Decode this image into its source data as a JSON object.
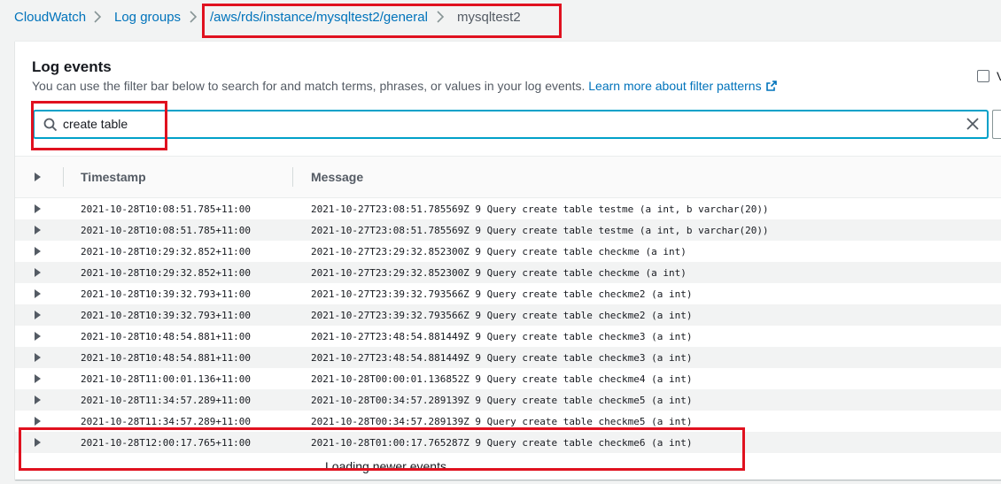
{
  "breadcrumb": {
    "items": [
      {
        "label": "CloudWatch"
      },
      {
        "label": "Log groups"
      },
      {
        "label": "/aws/rds/instance/mysqltest2/general"
      },
      {
        "label": "mysqltest2"
      }
    ]
  },
  "log_events": {
    "title": "Log events",
    "description": "You can use the filter bar below to search for and match terms, phrases, or values in your log events.",
    "learn_more": "Learn more about filter patterns",
    "checkbox_label": "V"
  },
  "search": {
    "value": "create table",
    "icon": "search-icon",
    "clear_icon": "close-icon"
  },
  "table": {
    "columns": {
      "timestamp": "Timestamp",
      "message": "Message"
    },
    "rows": [
      {
        "timestamp": "2021-10-28T10:08:51.785+11:00",
        "message": "2021-10-27T23:08:51.785569Z 9 Query create table testme (a int, b varchar(20))"
      },
      {
        "timestamp": "2021-10-28T10:08:51.785+11:00",
        "message": "2021-10-27T23:08:51.785569Z 9 Query create table testme (a int, b varchar(20))"
      },
      {
        "timestamp": "2021-10-28T10:29:32.852+11:00",
        "message": "2021-10-27T23:29:32.852300Z 9 Query create table checkme (a int)"
      },
      {
        "timestamp": "2021-10-28T10:29:32.852+11:00",
        "message": "2021-10-27T23:29:32.852300Z 9 Query create table checkme (a int)"
      },
      {
        "timestamp": "2021-10-28T10:39:32.793+11:00",
        "message": "2021-10-27T23:39:32.793566Z 9 Query create table checkme2 (a int)"
      },
      {
        "timestamp": "2021-10-28T10:39:32.793+11:00",
        "message": "2021-10-27T23:39:32.793566Z 9 Query create table checkme2 (a int)"
      },
      {
        "timestamp": "2021-10-28T10:48:54.881+11:00",
        "message": "2021-10-27T23:48:54.881449Z 9 Query create table checkme3 (a int)"
      },
      {
        "timestamp": "2021-10-28T10:48:54.881+11:00",
        "message": "2021-10-27T23:48:54.881449Z 9 Query create table checkme3 (a int)"
      },
      {
        "timestamp": "2021-10-28T11:00:01.136+11:00",
        "message": "2021-10-28T00:00:01.136852Z 9 Query create table checkme4 (a int)"
      },
      {
        "timestamp": "2021-10-28T11:34:57.289+11:00",
        "message": "2021-10-28T00:34:57.289139Z 9 Query create table checkme5 (a int)"
      },
      {
        "timestamp": "2021-10-28T11:34:57.289+11:00",
        "message": "2021-10-28T00:34:57.289139Z 9 Query create table checkme5 (a int)"
      },
      {
        "timestamp": "2021-10-28T12:00:17.765+11:00",
        "message": "2021-10-28T01:00:17.765287Z 9 Query create table checkme6 (a int)"
      }
    ],
    "loading_text": "Loading newer events"
  },
  "colors": {
    "link": "#0073bb",
    "highlight_box": "#e0111f",
    "focus": "#00a1c9"
  }
}
